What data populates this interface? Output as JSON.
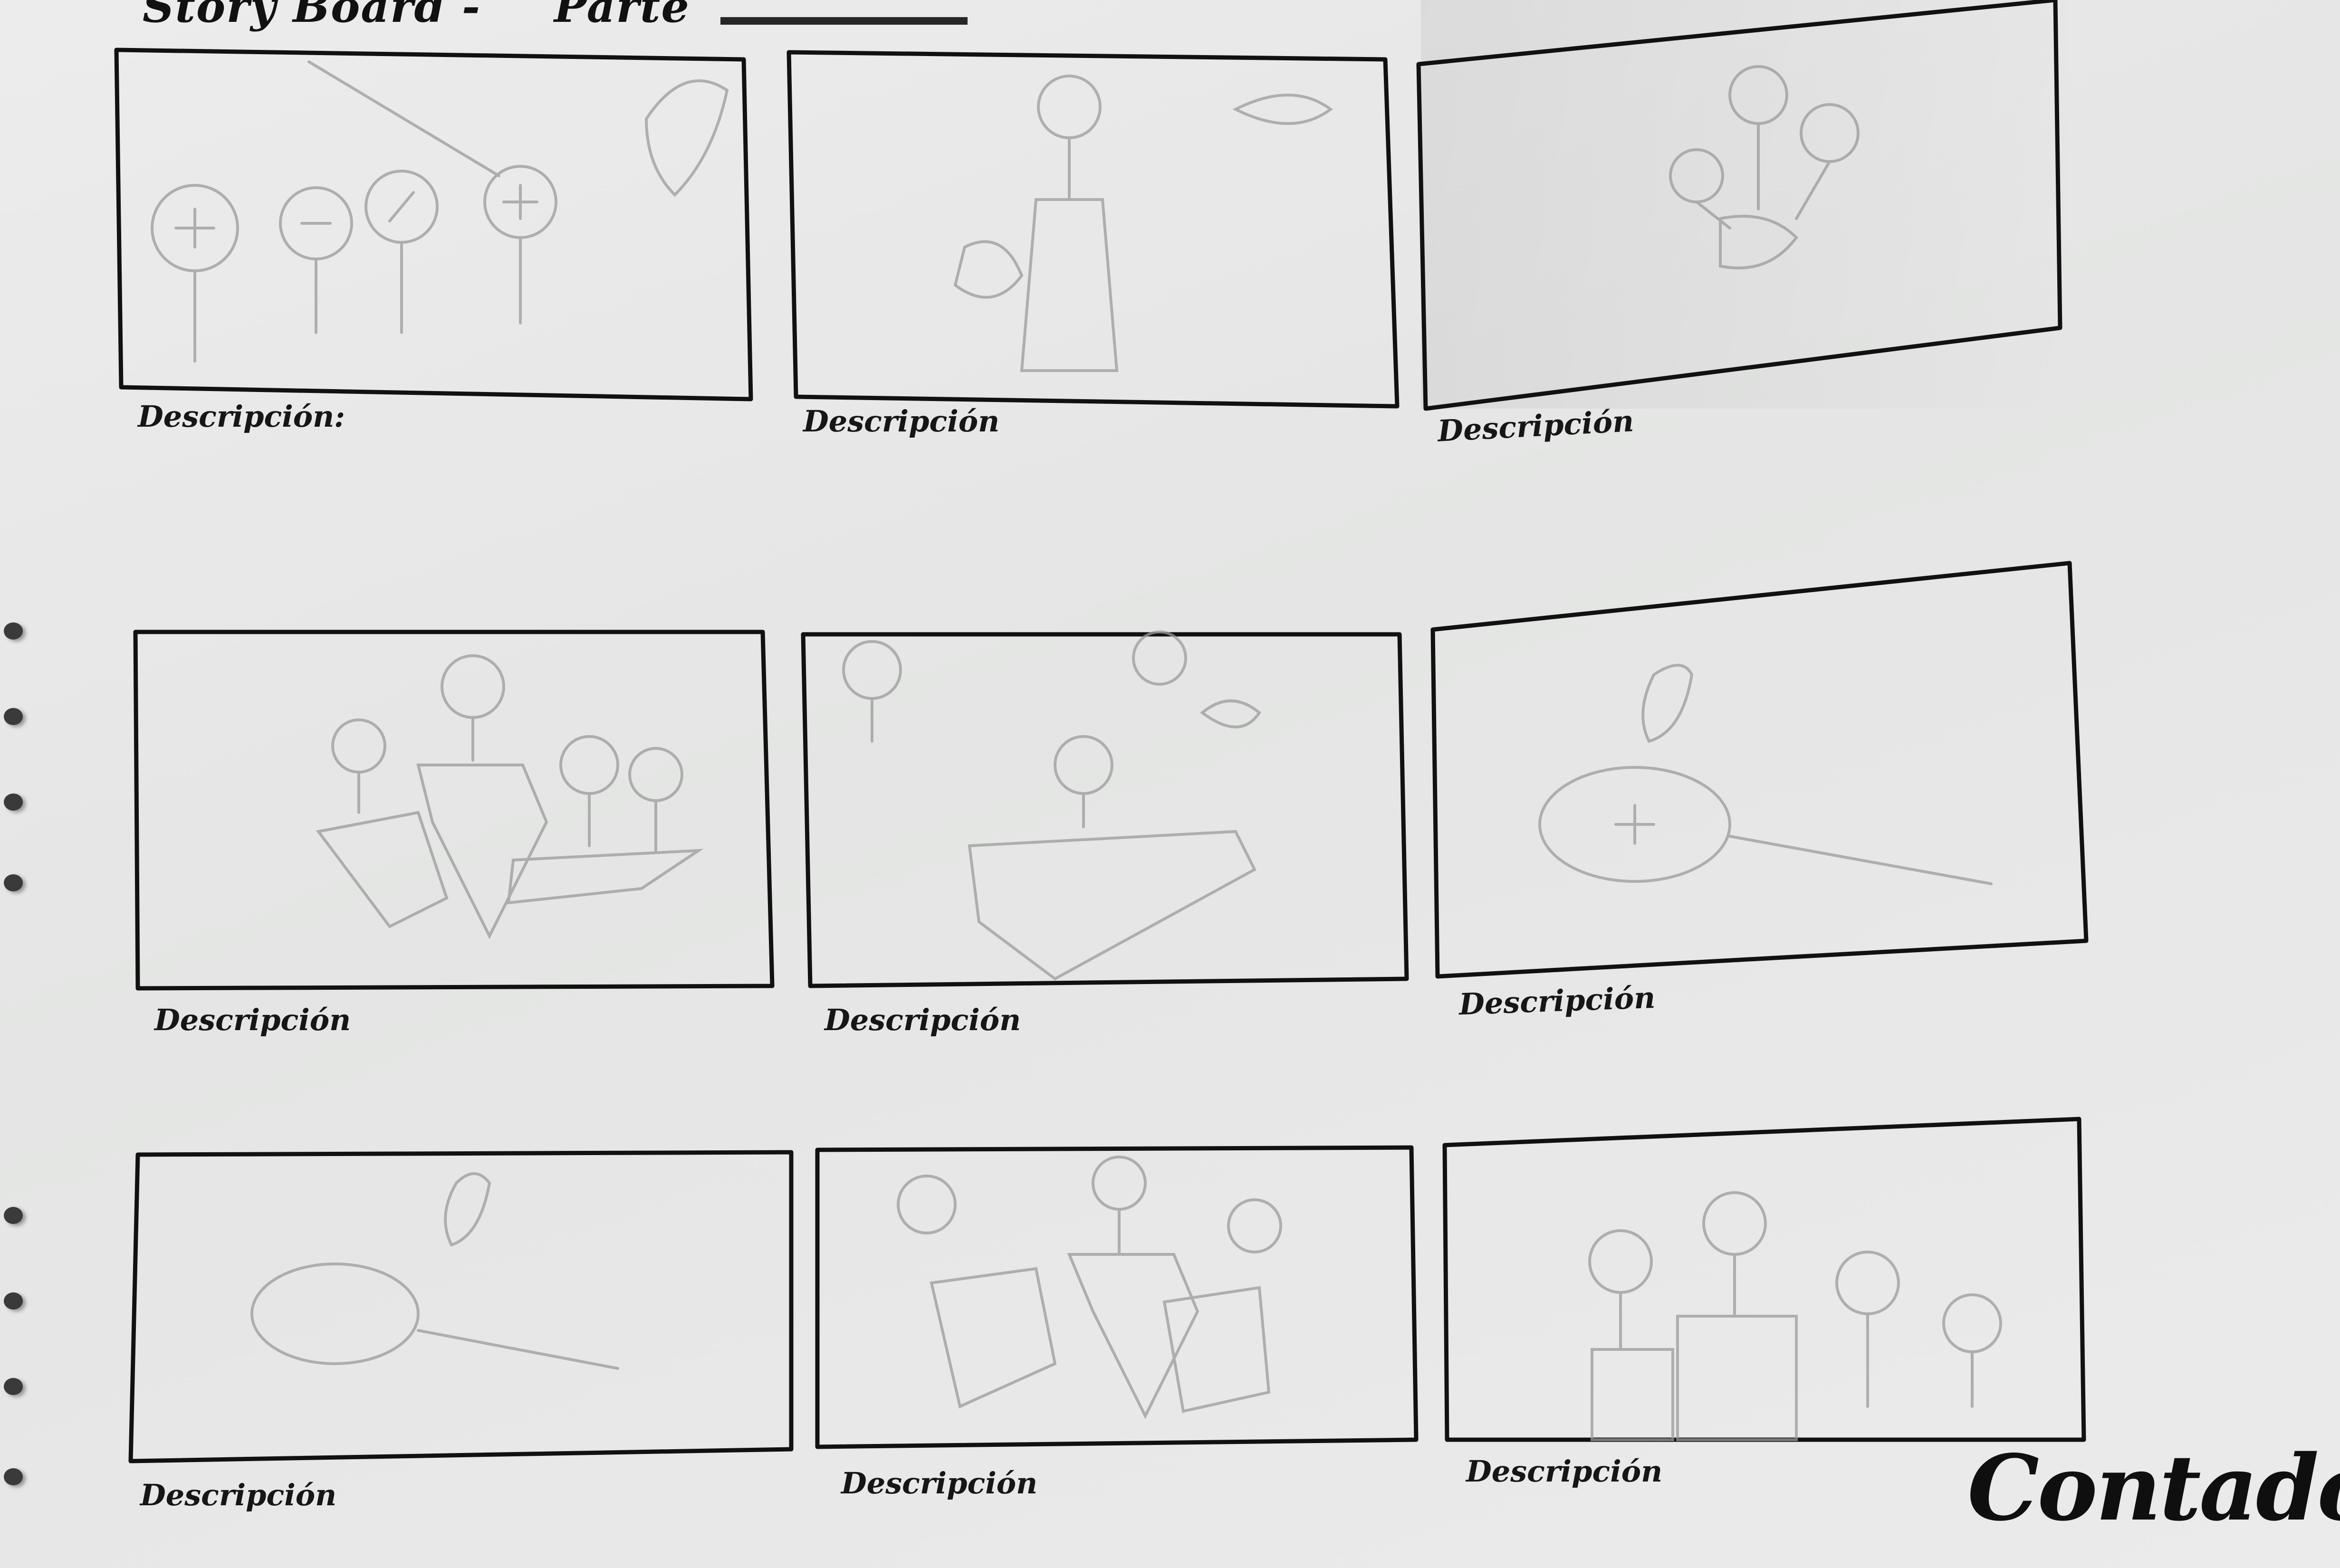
{
  "header": {
    "title": "Story Board -",
    "part_label": "Parte"
  },
  "panels": [
    {
      "label": "Descripción:"
    },
    {
      "label": "Descripción"
    },
    {
      "label": "Descripción"
    },
    {
      "label": "Descripción"
    },
    {
      "label": "Descripción"
    },
    {
      "label": "Descripción"
    },
    {
      "label": "Descripción"
    },
    {
      "label": "Descripción"
    },
    {
      "label": "Descripción"
    }
  ],
  "signature": "Contador",
  "colors": {
    "paper": "#e7e8e7",
    "ink": "#111111",
    "pencil": "#9b9b9b"
  }
}
